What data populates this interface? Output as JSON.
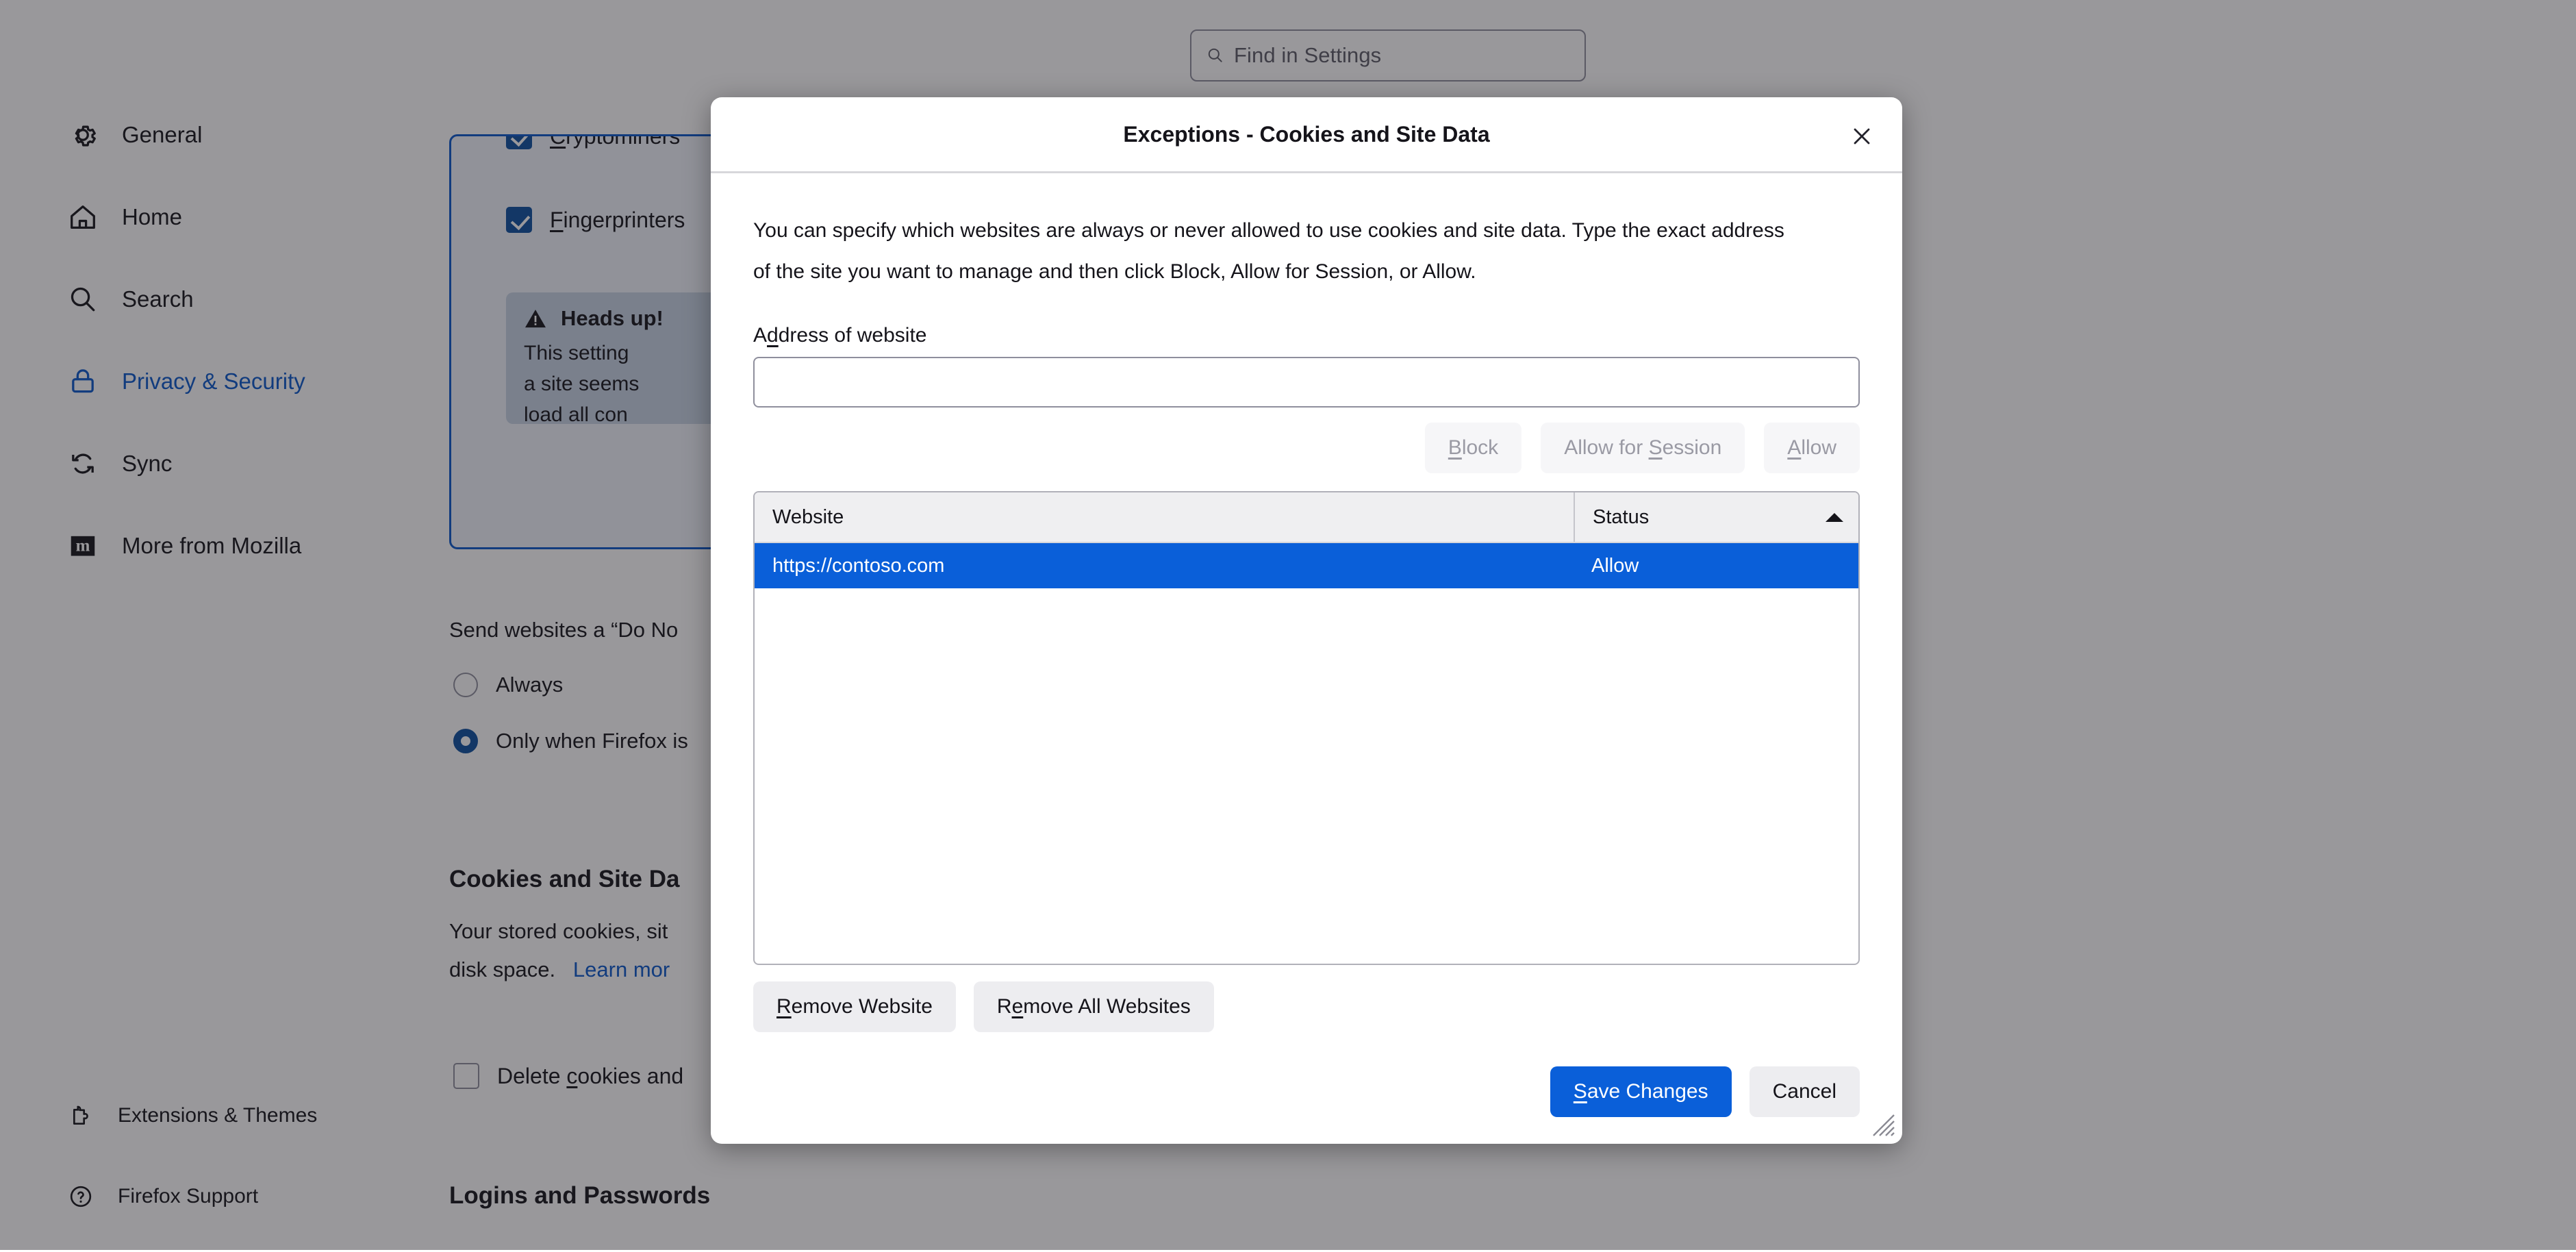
{
  "search": {
    "placeholder": "Find in Settings",
    "icon": "search-icon"
  },
  "sidebar": {
    "items": [
      {
        "label": "General",
        "icon": "gear-icon",
        "selected": false
      },
      {
        "label": "Home",
        "icon": "home-icon",
        "selected": false
      },
      {
        "label": "Search",
        "icon": "search-icon",
        "selected": false
      },
      {
        "label": "Privacy & Security",
        "icon": "lock-icon",
        "selected": true
      },
      {
        "label": "Sync",
        "icon": "sync-icon",
        "selected": false
      },
      {
        "label": "More from Mozilla",
        "icon": "mozilla-m-icon",
        "selected": false
      }
    ],
    "bottom_items": [
      {
        "label": "Extensions & Themes",
        "icon": "puzzle-piece-icon"
      },
      {
        "label": "Firefox Support",
        "icon": "question-circle-icon"
      }
    ]
  },
  "content": {
    "checkbox_cryptominers": {
      "label": "Cryptominers",
      "accesskey": "C",
      "checked": true
    },
    "checkbox_fingerprinters": {
      "label": "Fingerprinters",
      "accesskey": "F",
      "checked": true
    },
    "heads_up": {
      "icon": "warning-triangle-icon",
      "title": "Heads up!",
      "lines": [
        "This setting",
        "a site seems",
        "load all con"
      ]
    },
    "do_not_track": {
      "title": "Send websites a “Do No",
      "options": [
        {
          "label": "Always",
          "selected": false
        },
        {
          "label": "Only when Firefox is",
          "selected": true
        }
      ]
    },
    "cookies_section": {
      "title": "Cookies and Site Da",
      "body_line1": "Your stored cookies, sit",
      "body_line2": "disk space.",
      "learn_more": "Learn mor"
    },
    "delete_cookies": {
      "label_before": "Delete ",
      "accesskey": "c",
      "label_after": "ookies and",
      "checked": false
    },
    "logins_section": {
      "title": "Logins and Passwords"
    }
  },
  "dialog": {
    "title": "Exceptions - Cookies and Site Data",
    "close_icon": "close-icon",
    "description": "You can specify which websites are always or never allowed to use cookies and site data. Type the exact address of the site you want to manage and then click Block, Allow for Session, or Allow.",
    "address_label_before": "A",
    "address_label_accesskey": "d",
    "address_label_after": "dress of website",
    "address_input_value": "",
    "permission_buttons": [
      {
        "before": "",
        "accesskey": "B",
        "after": "lock",
        "disabled": true,
        "name": "block-button"
      },
      {
        "before": "Allow for ",
        "accesskey": "S",
        "after": "ession",
        "disabled": true,
        "name": "allow-for-session-button"
      },
      {
        "before": "",
        "accesskey": "A",
        "after": "llow",
        "disabled": true,
        "name": "allow-button"
      }
    ],
    "table": {
      "columns": [
        {
          "label": "Website",
          "sorted": false
        },
        {
          "label": "Status",
          "sorted": true,
          "sort_direction": "ascending"
        }
      ],
      "rows": [
        {
          "website": "https://contoso.com",
          "status": "Allow",
          "selected": true
        }
      ]
    },
    "remove_buttons": [
      {
        "before": "",
        "accesskey": "R",
        "after": "emove Website",
        "name": "remove-website-button"
      },
      {
        "before": "R",
        "accesskey": "e",
        "after": "move All Websites",
        "name": "remove-all-websites-button"
      }
    ],
    "footer_buttons": [
      {
        "before": "",
        "accesskey": "S",
        "after": "ave Changes",
        "primary": true,
        "name": "save-changes-button"
      },
      {
        "before": "Cancel",
        "accesskey": "",
        "after": "",
        "primary": false,
        "name": "cancel-button"
      }
    ]
  },
  "colors": {
    "accent": "#0a5fd9",
    "selected_row": "#0a5fd9",
    "link": "#0a58ca",
    "sidebar_selected": "#0a58ca",
    "disabled_text": "#9a9aa4",
    "overlay": "rgba(28,27,34,0.45)"
  }
}
